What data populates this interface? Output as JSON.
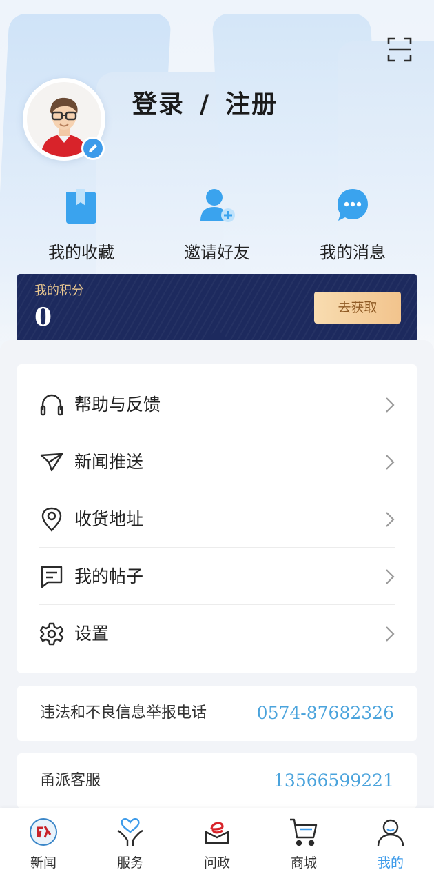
{
  "header": {
    "login_register": "登录",
    "slash": "/",
    "register": "注册",
    "scan_icon": "scan-icon",
    "avatar_icon": "user-avatar",
    "edit_icon": "pencil-icon"
  },
  "quick_actions": [
    {
      "label": "我的收藏",
      "icon": "bookmark-icon"
    },
    {
      "label": "邀请好友",
      "icon": "add-user-icon"
    },
    {
      "label": "我的消息",
      "icon": "chat-bubble-icon"
    }
  ],
  "points": {
    "label": "我的积分",
    "value": "0",
    "button": "去获取"
  },
  "menu": [
    {
      "label": "帮助与反馈",
      "icon": "headset-icon"
    },
    {
      "label": "新闻推送",
      "icon": "paper-plane-icon"
    },
    {
      "label": "收货地址",
      "icon": "location-pin-icon"
    },
    {
      "label": "我的帖子",
      "icon": "message-square-icon"
    },
    {
      "label": "设置",
      "icon": "gear-icon"
    }
  ],
  "contacts": [
    {
      "label": "违法和不良信息举报电话",
      "value": "0574-87682326"
    },
    {
      "label": "甬派客服",
      "value": "13566599221"
    }
  ],
  "tabs": [
    {
      "label": "新闻",
      "icon": "news-logo-icon"
    },
    {
      "label": "服务",
      "icon": "heart-hands-icon"
    },
    {
      "label": "问政",
      "icon": "e-gov-icon"
    },
    {
      "label": "商城",
      "icon": "cart-icon"
    },
    {
      "label": "我的",
      "icon": "profile-icon",
      "active": true
    }
  ],
  "colors": {
    "accent": "#3d9bea",
    "points_bg": "#1d2a5e",
    "points_label": "#e9c78f",
    "contact_value": "#4aa3dc"
  }
}
